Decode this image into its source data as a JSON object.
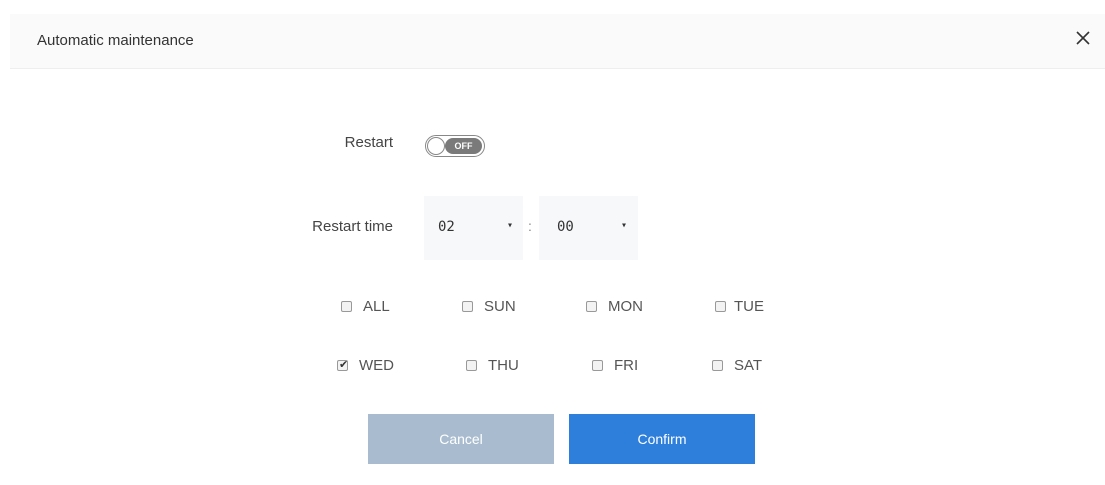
{
  "dialog": {
    "title": "Automatic maintenance",
    "close_icon": "close-icon"
  },
  "restart": {
    "label": "Restart",
    "toggle_state": "OFF",
    "enabled": false
  },
  "restart_time": {
    "label": "Restart time",
    "hour": "02",
    "separator": ":",
    "minute": "00",
    "arrow_glyph": "▾"
  },
  "days": [
    {
      "label": "ALL",
      "checked": false
    },
    {
      "label": "SUN",
      "checked": false
    },
    {
      "label": "MON",
      "checked": false
    },
    {
      "label": "TUE",
      "checked": false
    },
    {
      "label": "WED",
      "checked": true
    },
    {
      "label": "THU",
      "checked": false
    },
    {
      "label": "FRI",
      "checked": false
    },
    {
      "label": "SAT",
      "checked": false
    }
  ],
  "buttons": {
    "cancel": "Cancel",
    "confirm": "Confirm"
  },
  "colors": {
    "confirm": "#2e7fdc",
    "cancel": "#a9bccf",
    "header_bg": "#fafafa",
    "toggle_off": "#7a7a7a"
  }
}
